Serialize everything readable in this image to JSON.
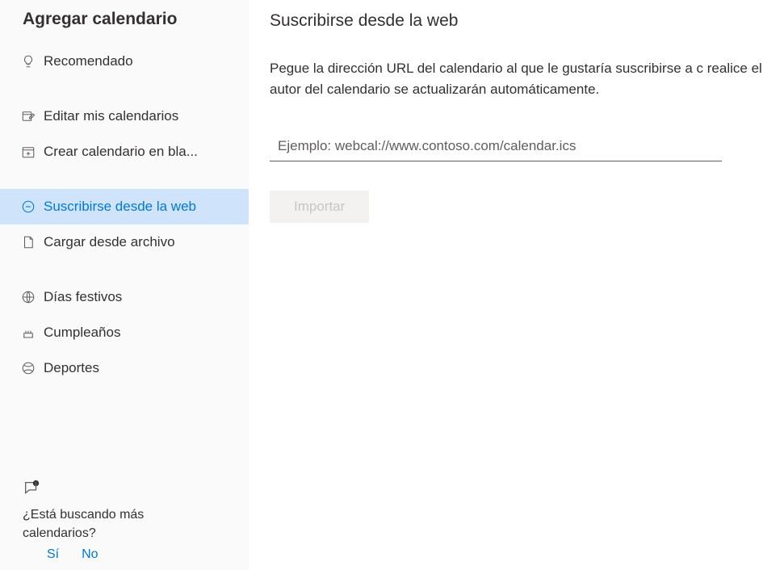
{
  "sidebar": {
    "title": "Agregar calendario",
    "items": [
      {
        "label": "Recomendado"
      },
      {
        "label": "Editar mis calendarios"
      },
      {
        "label": "Crear calendario en bla..."
      },
      {
        "label": "Suscribirse desde la web"
      },
      {
        "label": "Cargar desde archivo"
      },
      {
        "label": "Días festivos"
      },
      {
        "label": "Cumpleaños"
      },
      {
        "label": "Deportes"
      }
    ],
    "feedback": {
      "question": "¿Está buscando más calendarios?",
      "yes": "Sí",
      "no": "No"
    }
  },
  "main": {
    "title": "Suscribirse desde la web",
    "description": "Pegue la dirección URL del calendario al que le gustaría suscribirse a c realice el autor del calendario se actualizarán automáticamente.",
    "placeholder": "Ejemplo: webcal://www.contoso.com/calendar.ics",
    "import_label": "Importar"
  }
}
